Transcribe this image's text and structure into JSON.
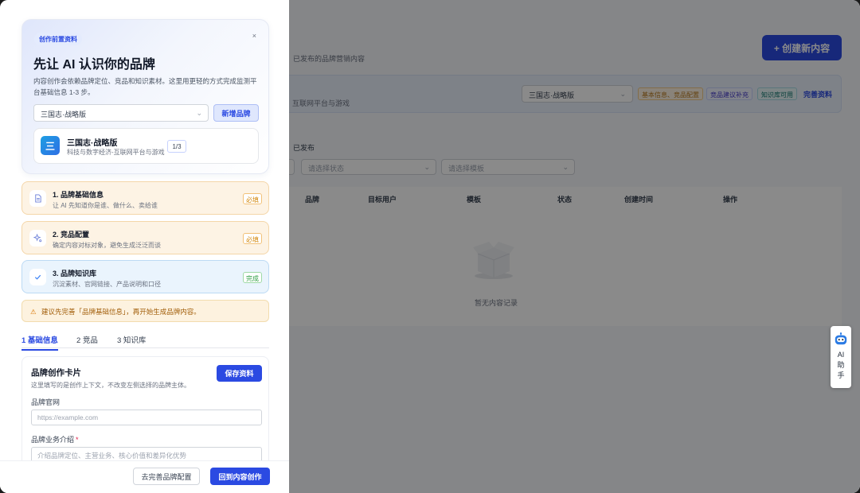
{
  "background": {
    "create_button": "+ 创建新内容",
    "subtitle": "已发布的品牌营销内容",
    "brand_bar_subtitle": "互联网平台与游戏",
    "brand_select": "三国志·战略版",
    "tags": [
      "基本信息、竞品配置",
      "竞品建议补充",
      "知识库可用"
    ],
    "complete_link": "完善资料",
    "section_title": "已发布",
    "filters": [
      "请选择状态",
      "请选择模板"
    ],
    "table_headers": [
      "品牌",
      "目标用户",
      "模板",
      "状态",
      "创建时间",
      "操作"
    ],
    "empty_text": "暂无内容记录"
  },
  "ai_assistant": {
    "label": "AI助手"
  },
  "drawer": {
    "badge": "创作前置资料",
    "close": "×",
    "title": "先让 AI 认识你的品牌",
    "description": "内容创作会依赖品牌定位、竞品和知识素材。这里用更轻的方式完成监测平台基础信息 1-3 步。",
    "brand_select": "三国志·战略版",
    "add_brand": "新增品牌",
    "brand_card": {
      "logo_char": "三",
      "name": "三国志·战略版",
      "category": "科技与数字经济-互联网平台与游戏",
      "count": "1/3"
    },
    "steps": [
      {
        "title": "1. 品牌基础信息",
        "desc": "让 AI 先知道你是谁、做什么、卖给谁",
        "tag": "必填",
        "icon": "document-icon"
      },
      {
        "title": "2. 竞品配置",
        "desc": "确定内容对标对象，避免生成泛泛而谈",
        "tag": "必填",
        "icon": "sparkle-icon"
      },
      {
        "title": "3. 品牌知识库",
        "desc": "沉淀素材、官网链接、产品说明和口径",
        "tag": "完成",
        "icon": "check-icon"
      }
    ],
    "warning": "建议先完善「品牌基础信息」，再开始生成品牌内容。",
    "tabs": [
      "1 基础信息",
      "2 竞品",
      "3 知识库"
    ],
    "form": {
      "title": "品牌创作卡片",
      "desc": "这里填写的是创作上下文，不改变左侧选择的品牌主体。",
      "save": "保存资料",
      "website_label": "品牌官网",
      "website_placeholder": "https://example.com",
      "intro_label": "品牌业务介绍",
      "intro_required": "*",
      "intro_placeholder": "介绍品牌定位、主营业务、核心价值和差异化优势"
    },
    "footer": {
      "secondary": "去完善品牌配置",
      "primary": "回到内容创作"
    }
  },
  "colors": {
    "primary": "#2b4ae2",
    "warning": "#d48a10",
    "success": "#2f9e44"
  }
}
